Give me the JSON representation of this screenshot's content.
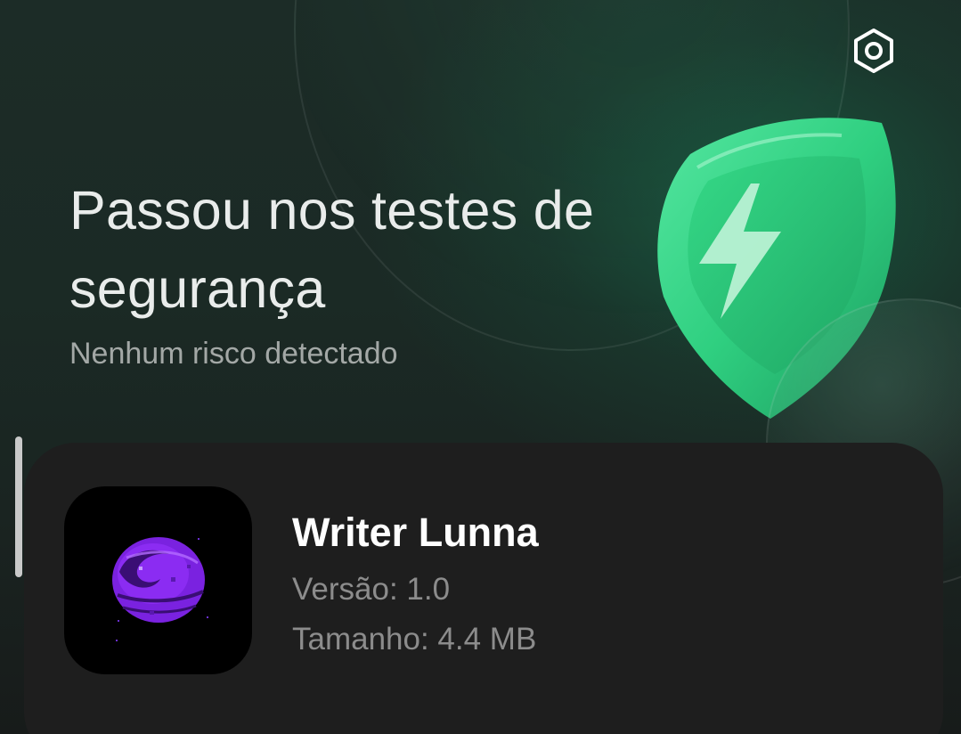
{
  "header": {
    "settings_icon": "settings-hexagon-icon",
    "title": "Passou nos testes de segurança",
    "subtitle": "Nenhum risco detectado",
    "illustration_icon": "shield-lightning-icon"
  },
  "app": {
    "name": "Writer Lunna",
    "version_text": "Versão: 1.0",
    "size_text": "Tamanho: 4.4 MB",
    "icon": "purple-planet-app-icon"
  },
  "colors": {
    "accent_green": "#2fd07f",
    "icon_purple": "#8a2be2",
    "card_background": "#1e1e1e"
  }
}
